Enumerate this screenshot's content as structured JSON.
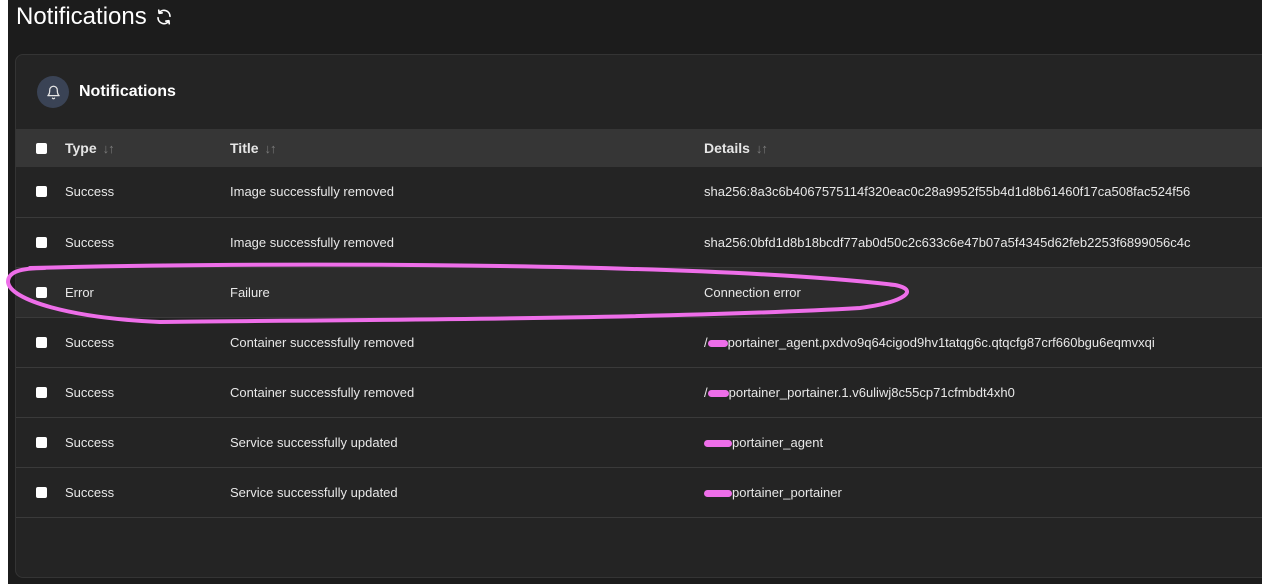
{
  "page": {
    "title": "Notifications",
    "refresh_icon": "refresh-icon"
  },
  "card": {
    "title": "Notifications",
    "icon": "bell-icon"
  },
  "table": {
    "columns": [
      {
        "label": "Type"
      },
      {
        "label": "Title"
      },
      {
        "label": "Details"
      }
    ],
    "rows": [
      {
        "type": "Success",
        "title": "Image successfully removed",
        "details": "sha256:8a3c6b4067575114f320eac0c28a9952f55b4d1d8b61460f17ca508fac524f56"
      },
      {
        "type": "Success",
        "title": "Image successfully removed",
        "details": "sha256:0bfd1d8b18bcdf77ab0d50c2c633c6e47b07a5f4345d62feb2253f6899056c4c"
      },
      {
        "type": "Error",
        "title": "Failure",
        "details": "Connection error"
      },
      {
        "type": "Success",
        "title": "Container successfully removed",
        "details_prefix": "/",
        "details": "portainer_agent.pxdvo9q64cigod9hv1tatqg6c.qtqcfg87crf660bgu6eqmvxqi"
      },
      {
        "type": "Success",
        "title": "Container successfully removed",
        "details_prefix": "/",
        "details": "portainer_portainer.1.v6uliwj8c55cp71cfmbdt4xh0"
      },
      {
        "type": "Success",
        "title": "Service successfully updated",
        "details": "portainer_agent"
      },
      {
        "type": "Success",
        "title": "Service successfully updated",
        "details": "portainer_portainer"
      }
    ]
  },
  "colors": {
    "background": "#1c1c1c",
    "card": "#242424",
    "header_row": "#363636",
    "annotation": "#ee6ee9"
  }
}
